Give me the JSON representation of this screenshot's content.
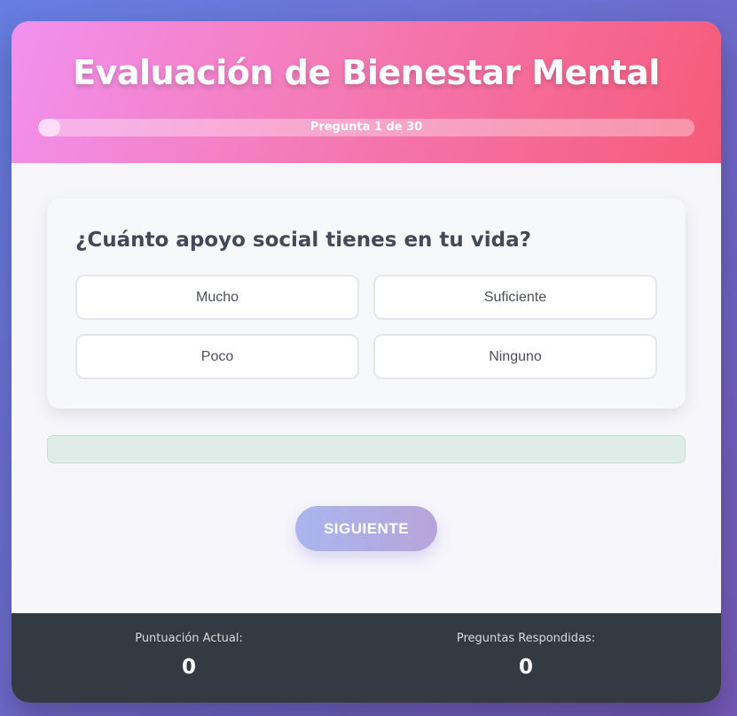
{
  "header": {
    "title": "Evaluación de Bienestar Mental",
    "progress_text": "Pregunta 1 de 30",
    "progress_fraction": 0.0333
  },
  "question": {
    "text": "¿Cuánto apoyo social tienes en tu vida?",
    "options": [
      "Mucho",
      "Suficiente",
      "Poco",
      "Ninguno"
    ]
  },
  "actions": {
    "next_label": "SIGUIENTE"
  },
  "footer": {
    "score_label": "Puntuación Actual:",
    "score_value": "0",
    "answered_label": "Preguntas Respondidas:",
    "answered_value": "0"
  }
}
